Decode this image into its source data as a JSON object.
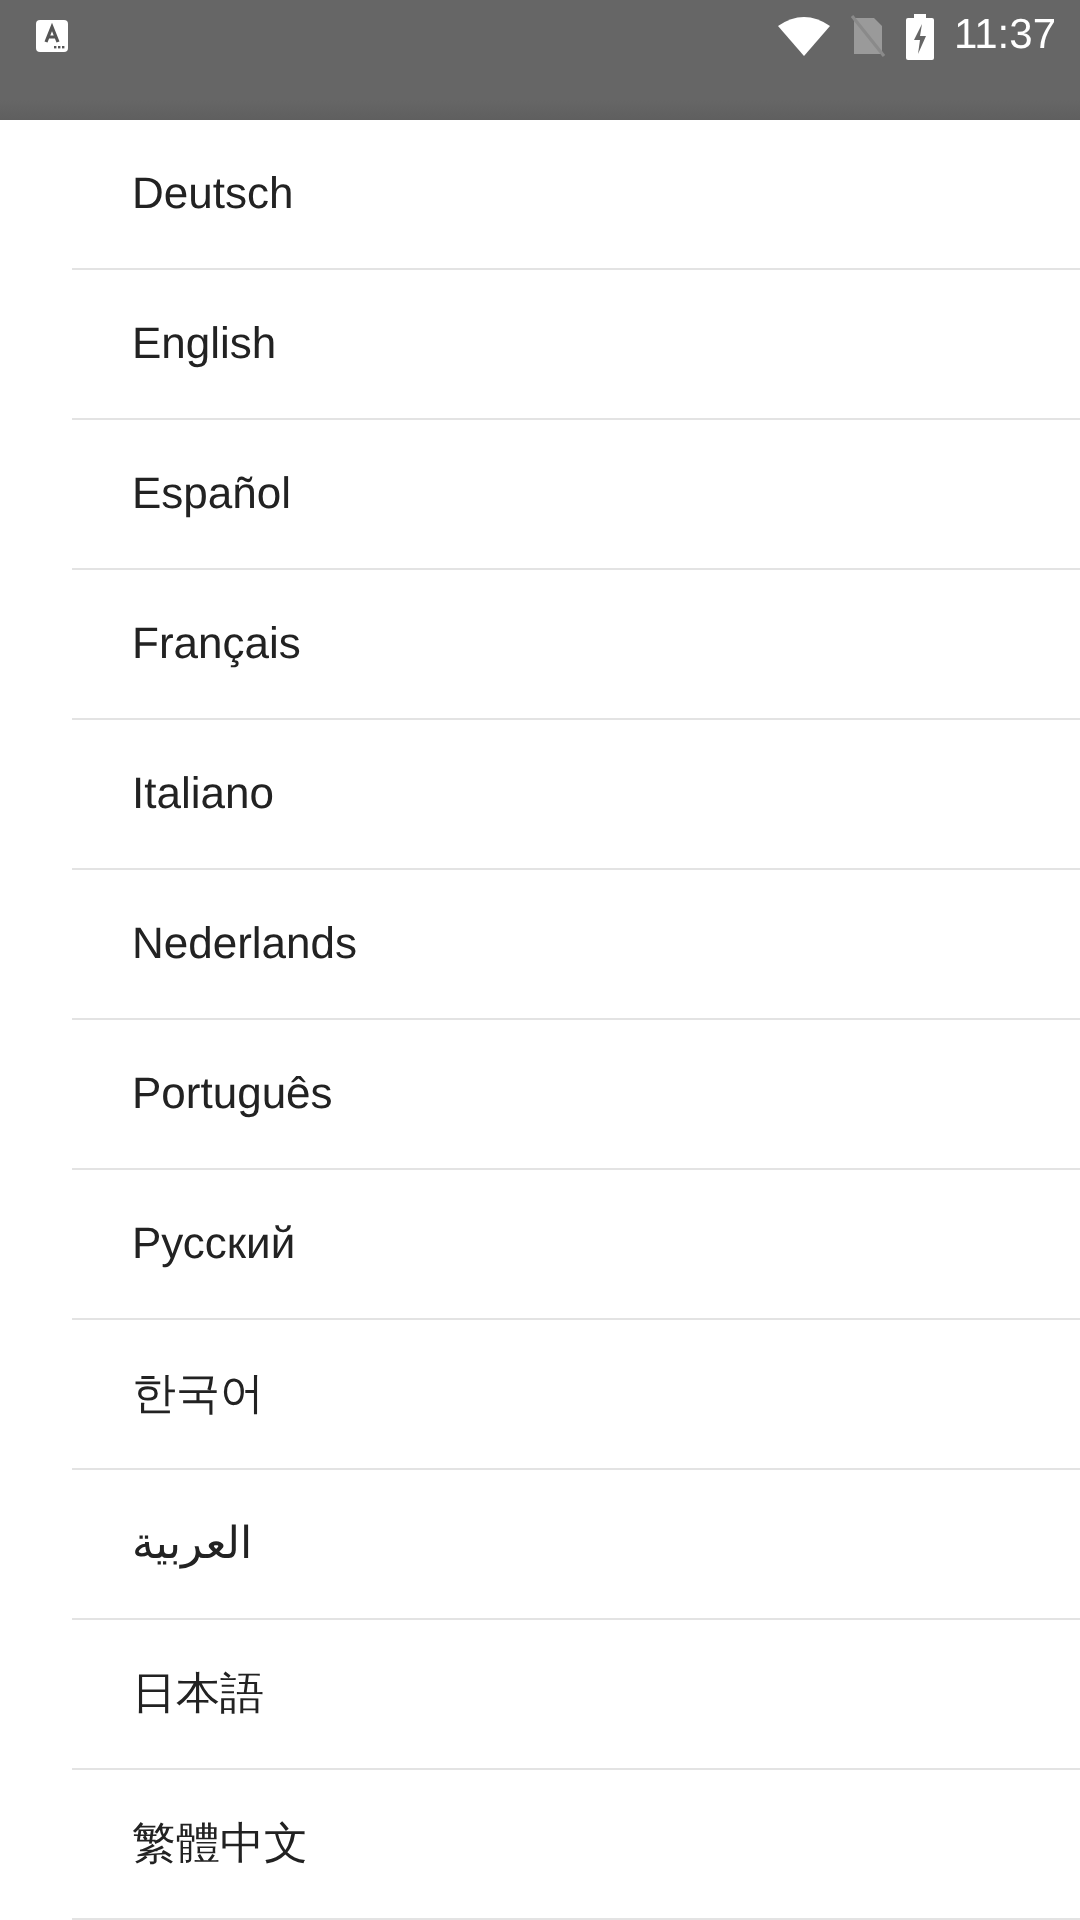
{
  "status_bar": {
    "time": "11:37"
  },
  "languages": [
    {
      "label": "Deutsch"
    },
    {
      "label": "English"
    },
    {
      "label": "Español"
    },
    {
      "label": "Français"
    },
    {
      "label": "Italiano"
    },
    {
      "label": "Nederlands"
    },
    {
      "label": "Português"
    },
    {
      "label": "Русский"
    },
    {
      "label": "한국어"
    },
    {
      "label": "العربية"
    },
    {
      "label": "日本語"
    },
    {
      "label": "繁體中文"
    }
  ]
}
